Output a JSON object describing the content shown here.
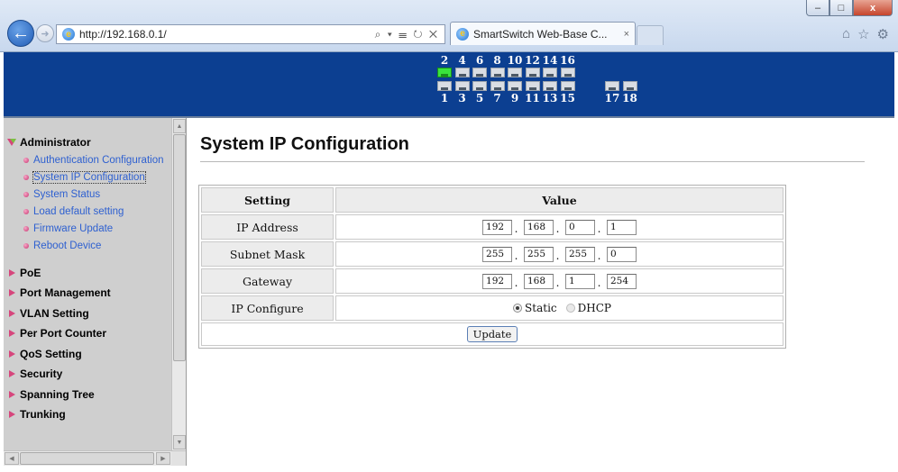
{
  "browser": {
    "address": "http://192.168.0.1/",
    "address_tools": "⌕ ▾ ☰ ↻ ✕",
    "tab_title": "SmartSwitch Web-Base C...",
    "tab_close": "×",
    "window_buttons": [
      "–",
      "□",
      "x"
    ]
  },
  "banner": {
    "top_port_numbers": [
      "2",
      "4",
      "6",
      "8",
      "10",
      "12",
      "14",
      "16"
    ],
    "bottom_port_numbers": [
      "1",
      "3",
      "5",
      "7",
      "9",
      "11",
      "13",
      "15"
    ],
    "uplink_port_numbers": [
      "17",
      "18"
    ],
    "active_ports": [
      "2"
    ],
    "active_color": "#39e33d",
    "background_color": "#0c3f91"
  },
  "sidebar": {
    "sections": [
      {
        "label": "Administrator",
        "expanded": true,
        "items": [
          {
            "label": "Authentication Configuration"
          },
          {
            "label": "System IP Configuration",
            "selected": true
          },
          {
            "label": "System Status"
          },
          {
            "label": "Load default setting"
          },
          {
            "label": "Firmware Update"
          },
          {
            "label": "Reboot Device"
          }
        ]
      },
      {
        "label": "PoE"
      },
      {
        "label": "Port Management"
      },
      {
        "label": "VLAN Setting"
      },
      {
        "label": "Per Port Counter"
      },
      {
        "label": "QoS Setting"
      },
      {
        "label": "Security"
      },
      {
        "label": "Spanning Tree"
      },
      {
        "label": "Trunking"
      }
    ]
  },
  "main": {
    "title": "System IP Configuration",
    "table": {
      "headers": {
        "setting": "Setting",
        "value": "Value"
      },
      "ip_address": {
        "label": "IP Address",
        "octets": [
          "192",
          "168",
          "0",
          "1"
        ]
      },
      "subnet_mask": {
        "label": "Subnet Mask",
        "octets": [
          "255",
          "255",
          "255",
          "0"
        ]
      },
      "gateway": {
        "label": "Gateway",
        "octets": [
          "192",
          "168",
          "1",
          "254"
        ]
      },
      "ip_configure": {
        "label": "IP Configure",
        "options": [
          "Static",
          "DHCP"
        ],
        "selected": "Static"
      },
      "update_label": "Update"
    }
  }
}
